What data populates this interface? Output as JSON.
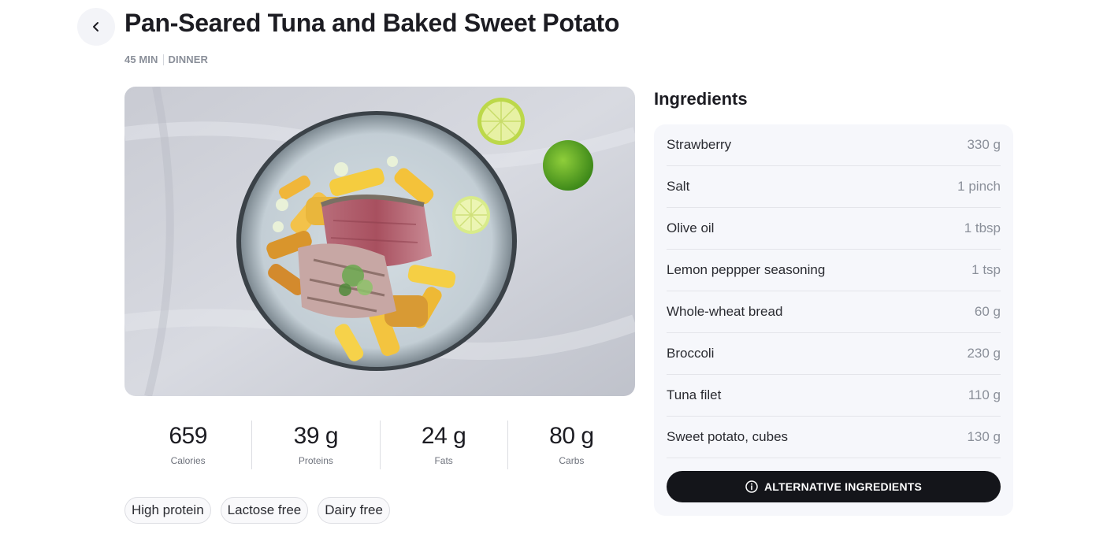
{
  "recipe": {
    "title": "Pan-Seared Tuna and Baked Sweet Potato",
    "duration": "45 MIN",
    "meal_type": "DINNER"
  },
  "nutrition": [
    {
      "value": "659",
      "label": "Calories"
    },
    {
      "value": "39 g",
      "label": "Proteins"
    },
    {
      "value": "24 g",
      "label": "Fats"
    },
    {
      "value": "80 g",
      "label": "Carbs"
    }
  ],
  "tags": [
    "High protein",
    "Lactose free",
    "Dairy free"
  ],
  "ingredients": {
    "heading": "Ingredients",
    "items": [
      {
        "name": "Strawberry",
        "qty": "330 g"
      },
      {
        "name": "Salt",
        "qty": "1 pinch"
      },
      {
        "name": "Olive oil",
        "qty": "1 tbsp"
      },
      {
        "name": "Lemon peppper seasoning",
        "qty": "1 tsp"
      },
      {
        "name": "Whole-wheat bread",
        "qty": "60 g"
      },
      {
        "name": "Broccoli",
        "qty": "230 g"
      },
      {
        "name": "Tuna filet",
        "qty": "110 g"
      },
      {
        "name": "Sweet potato, cubes",
        "qty": "130 g"
      }
    ],
    "alternative_label": "ALTERNATIVE INGREDIENTS"
  },
  "icons": {
    "back": "chevron-left-icon",
    "info": "info-circle-icon"
  },
  "colors": {
    "button_dark": "#14151a",
    "panel_bg": "#f6f7fb",
    "muted_text": "#8a8f99"
  }
}
